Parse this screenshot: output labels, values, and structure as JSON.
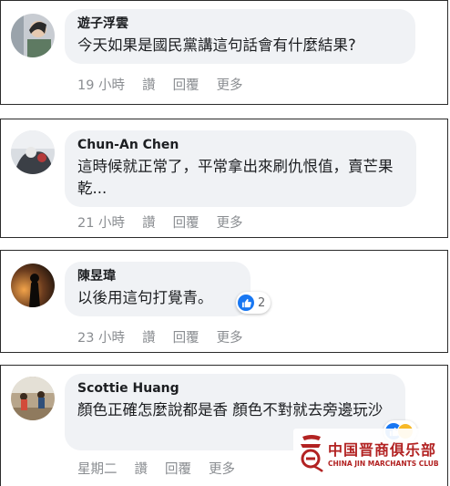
{
  "colors": {
    "bubble_bg": "#f0f2f5",
    "meta_text": "#8a8d91",
    "like_blue": "#1877f2",
    "watermark_red": "#b22222"
  },
  "comments": [
    {
      "author": "遊子浮雲",
      "text": "今天如果是國民黨講這句話會有什麼結果?",
      "time": "19 小時",
      "like_label": "讚",
      "reply_label": "回覆",
      "more_label": "更多"
    },
    {
      "author": "Chun-An Chen",
      "text": "這時候就正常了，平常拿出來刷仇恨值，賣芒果乾...",
      "time": "21 小時",
      "like_label": "讚",
      "reply_label": "回覆",
      "more_label": "更多"
    },
    {
      "author": "陳昱瑋",
      "text": "以後用這句打覺青。",
      "time": "23 小時",
      "like_label": "讚",
      "reply_label": "回覆",
      "more_label": "更多",
      "reaction_count": "2"
    },
    {
      "author": "Scottie Huang",
      "text": "顏色正確怎麼說都是香 顏色不對就去旁邊玩沙",
      "time": "星期二",
      "like_label": "讚",
      "reply_label": "回覆",
      "more_label": "更多"
    }
  ],
  "watermark": {
    "chinese": "中国晋商俱乐部",
    "english": "CHINA JIN MARCHANTS CLUB"
  }
}
